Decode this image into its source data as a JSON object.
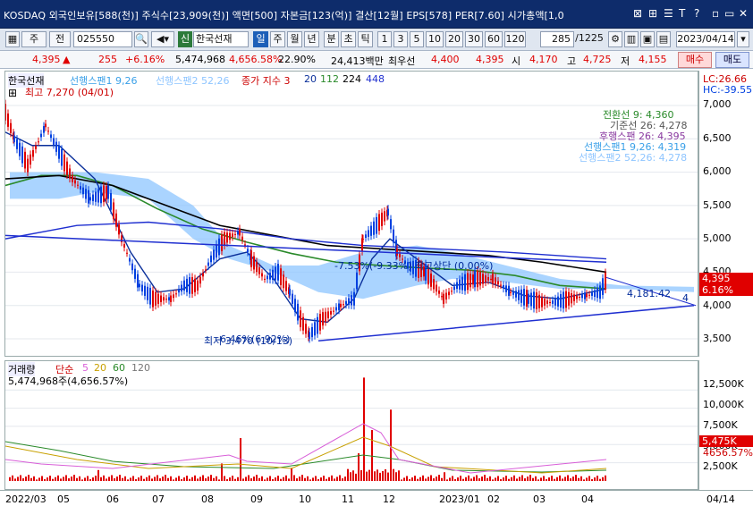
{
  "titlebar": {
    "text": "KOSDAQ 외국인보유[588(천)] 주식수[23,909(천)] 액면[500] 자본금[123(억)] 결산[12월] EPS[578] PER[7.60] 시가총액[1,0",
    "controls": [
      "⊠",
      "⊞",
      "☰",
      "T",
      "?",
      "▫",
      "▭",
      "✕"
    ]
  },
  "toolbar": {
    "type_btn": "주",
    "period_btn": "전",
    "code": "025550",
    "name": "한국선재",
    "new_badge": "신",
    "periods": [
      "일",
      "주",
      "월",
      "년",
      "분",
      "초",
      "틱"
    ],
    "intervals": [
      "1",
      "3",
      "5",
      "10",
      "20",
      "30",
      "60",
      "120"
    ],
    "count": "285",
    "total": "/1225",
    "date": "2023/04/14"
  },
  "info": {
    "price": "4,395",
    "arrow": "▲",
    "change": "255",
    "rate": "+6.16%",
    "volume": "5,474,968",
    "vol_rate": "4,656.58%",
    "turnover": "22.90%",
    "amount": "24,413백만",
    "best_label": "최우선",
    "best_ask": "4,400",
    "best_bid": "4,395",
    "open_label": "시",
    "open": "4,170",
    "high_label": "고",
    "high": "4,725",
    "low_label": "저",
    "low": "4,155",
    "buy": "매수",
    "sell": "매도"
  },
  "price_chart": {
    "legend": {
      "name": "한국선재",
      "span1": "선행스팬1 9,26",
      "span2": "선행스팬2 52,26",
      "ma_label": "종가 지수 3",
      "ma": [
        "20",
        "112",
        "224",
        "448"
      ]
    },
    "high_note": "최고 7,270 (04/01)",
    "low_note": "최저 3,470 (10/13)",
    "low_pct": "-6.46%(6.92%)",
    "ichimoku": [
      "전환선 9: 4,360",
      "기준선 26: 4,278",
      "후행스팬 26: 4,395",
      "선행스팬1 9,26: 4,319",
      "선행스팬2 52,26: 4,278"
    ],
    "trend_note": "-7.53%(-9.33%) 최고상단 (0.00%)",
    "trend_value": "4,181.42",
    "trend_id": "4",
    "lc": "LC:26.66",
    "hc": "HC:-39.55",
    "price_tag": "4,395",
    "rate_tag": "6.16%",
    "y_ticks": [
      "7,000",
      "6,500",
      "6,000",
      "5,500",
      "5,000",
      "4,500",
      "4,000",
      "3,500"
    ]
  },
  "volume_chart": {
    "legend": {
      "name": "거래량",
      "ma_label": "단순",
      "ma": [
        "5",
        "20",
        "60",
        "120"
      ]
    },
    "value": "5,474,968주(4,656.57%)",
    "y_ticks": [
      "12,500K",
      "10,000K",
      "7,500K",
      "5,000K",
      "2,500K"
    ],
    "tag_vol": "5,475K",
    "tag_pct": "4656.57%"
  },
  "x_axis": [
    "2022/03",
    "05",
    "06",
    "07",
    "08",
    "09",
    "10",
    "11",
    "12",
    "2023/01",
    "02",
    "03",
    "04"
  ],
  "x_end": "04/14",
  "colors": {
    "up": "#e00000",
    "down": "#0040e0",
    "cloud": "#8ec5ff",
    "ma20": "#0a2f9a",
    "ma112": "#2a8a2a",
    "ma224": "#000000",
    "ma448": "#1f2fd0"
  }
}
